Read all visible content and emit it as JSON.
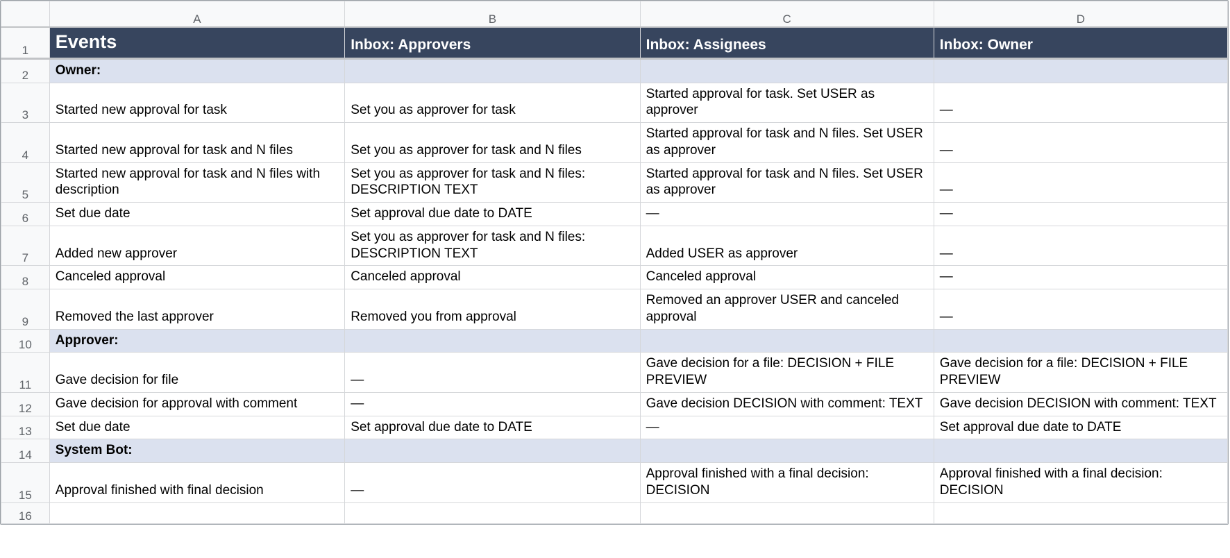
{
  "columns": {
    "A": "A",
    "B": "B",
    "C": "C",
    "D": "D"
  },
  "rows": [
    {
      "num": "1",
      "type": "title",
      "cells": {
        "A": "Events",
        "B": "Inbox: Approvers",
        "C": "Inbox: Assignees",
        "D": "Inbox: Owner"
      }
    },
    {
      "num": "2",
      "type": "section",
      "cells": {
        "A": "Owner:",
        "B": "",
        "C": "",
        "D": ""
      }
    },
    {
      "num": "3",
      "type": "data",
      "cells": {
        "A": "Started new approval for task",
        "B": "Set you as approver for task",
        "C": "Started approval for task. Set USER as approver",
        "D": "—"
      }
    },
    {
      "num": "4",
      "type": "data",
      "cells": {
        "A": "Started new approval for task and N files",
        "B": "Set you as approver for task and N files",
        "C": "Started approval for task and N files. Set USER as approver",
        "D": "—"
      }
    },
    {
      "num": "5",
      "type": "data",
      "cells": {
        "A": "Started new approval for task and N files with description",
        "B": "Set you as approver for task and N files: DESCRIPTION TEXT",
        "C": "Started approval for task and N files. Set USER as approver",
        "D": "—"
      }
    },
    {
      "num": "6",
      "type": "data",
      "cells": {
        "A": "Set due date",
        "B": "Set approval due date to DATE",
        "C": "—",
        "D": "—"
      }
    },
    {
      "num": "7",
      "type": "data",
      "cells": {
        "A": "Added new approver",
        "B": "Set you as approver for task and N files: DESCRIPTION TEXT",
        "C": "Added USER as approver",
        "D": "—"
      }
    },
    {
      "num": "8",
      "type": "data",
      "cells": {
        "A": "Canceled approval",
        "B": "Canceled approval",
        "C": "Canceled approval",
        "D": "—"
      }
    },
    {
      "num": "9",
      "type": "data",
      "cells": {
        "A": "Removed the last approver",
        "B": "Removed you from approval",
        "C": "Removed an approver USER and canceled approval",
        "D": "—"
      }
    },
    {
      "num": "10",
      "type": "section",
      "cells": {
        "A": "Approver:",
        "B": "",
        "C": "",
        "D": ""
      }
    },
    {
      "num": "11",
      "type": "data",
      "cells": {
        "A": "Gave decision for file",
        "B": "—",
        "C": "Gave decision for a file: DECISION + FILE PREVIEW",
        "D": "Gave decision for a file: DECISION + FILE PREVIEW"
      }
    },
    {
      "num": "12",
      "type": "data",
      "cells": {
        "A": "Gave decision for approval with comment",
        "B": "—",
        "C": "Gave decision DECISION with comment: TEXT",
        "D": "Gave decision DECISION with comment: TEXT"
      }
    },
    {
      "num": "13",
      "type": "data",
      "cells": {
        "A": "Set due date",
        "B": "Set approval due date to DATE",
        "C": "—",
        "D": "Set approval due date to DATE"
      }
    },
    {
      "num": "14",
      "type": "section",
      "cells": {
        "A": "System Bot:",
        "B": "",
        "C": "",
        "D": ""
      }
    },
    {
      "num": "15",
      "type": "data",
      "cells": {
        "A": "Approval finished with final decision",
        "B": "—",
        "C": "Approval finished with a final decision: DECISION",
        "D": "Approval finished with a final decision: DECISION"
      }
    },
    {
      "num": "16",
      "type": "data",
      "cells": {
        "A": "",
        "B": "",
        "C": "",
        "D": ""
      }
    }
  ]
}
